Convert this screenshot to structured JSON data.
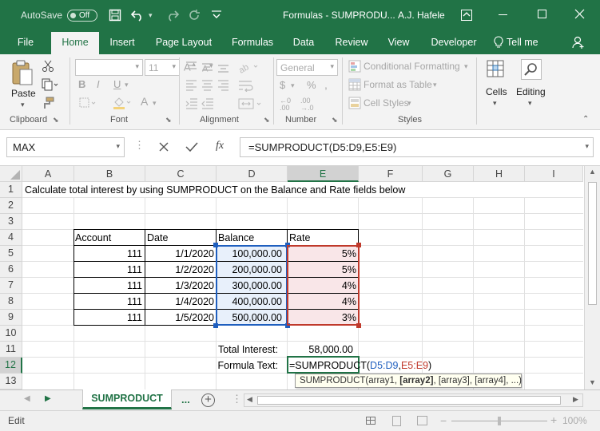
{
  "title_bar": {
    "autosave_label": "AutoSave",
    "autosave_state": "Off",
    "doc_title": "Formulas - SUMPRODU...",
    "user": "A.J. Hafele"
  },
  "tabs": [
    "File",
    "Home",
    "Insert",
    "Page Layout",
    "Formulas",
    "Data",
    "Review",
    "Developer"
  ],
  "tell_me": "Tell me",
  "ribbon": {
    "paste": "Paste",
    "font_size": "11",
    "number_format": "General",
    "conditional_formatting": "Conditional Formatting",
    "format_as_table": "Format as Table",
    "cell_styles": "Cell Styles",
    "cells": "Cells",
    "editing": "Editing",
    "groups": [
      "Clipboard",
      "Font",
      "Alignment",
      "Number",
      "Styles"
    ]
  },
  "formula_bar": {
    "name_box": "MAX",
    "formula": "=SUMPRODUCT(D5:D9,E5:E9)"
  },
  "columns": [
    "A",
    "B",
    "C",
    "D",
    "E",
    "F",
    "G",
    "H",
    "I"
  ],
  "rows": [
    "1",
    "2",
    "3",
    "4",
    "5",
    "6",
    "7",
    "8",
    "9",
    "10",
    "11",
    "12",
    "13"
  ],
  "sheet": {
    "instructions": "Calculate total interest by using SUMPRODUCT on the Balance and Rate fields below",
    "headers": [
      "Account",
      "Date",
      "Balance",
      "Rate"
    ],
    "table": [
      [
        "111",
        "1/1/2020",
        "100,000.00",
        "5%"
      ],
      [
        "111",
        "1/2/2020",
        "200,000.00",
        "5%"
      ],
      [
        "111",
        "1/3/2020",
        "300,000.00",
        "4%"
      ],
      [
        "111",
        "1/4/2020",
        "400,000.00",
        "4%"
      ],
      [
        "111",
        "1/5/2020",
        "500,000.00",
        "3%"
      ]
    ],
    "total_label": "Total Interest:",
    "total_value": "58,000.00",
    "formula_label": "Formula Text:",
    "edit_prefix": "=SUMPRODUCT(",
    "edit_arg1": "D5:D9",
    "edit_comma": ",",
    "edit_arg2": "E5:E9",
    "edit_suffix": ")",
    "tooltip_prefix": "SUMPRODUCT(array1, ",
    "tooltip_bold": "[array2]",
    "tooltip_suffix": ", [array3], [array4], ...)"
  },
  "sheet_tabs": {
    "active": "SUMPRODUCT",
    "more": "..."
  },
  "status": {
    "mode": "Edit",
    "zoom": "100%"
  },
  "colors": {
    "excel_green": "#217346",
    "range_blue": "#1f5fbf",
    "range_red": "#c0392b",
    "blue_fill": "#e8f0fb",
    "red_fill": "#f9e6e8"
  }
}
